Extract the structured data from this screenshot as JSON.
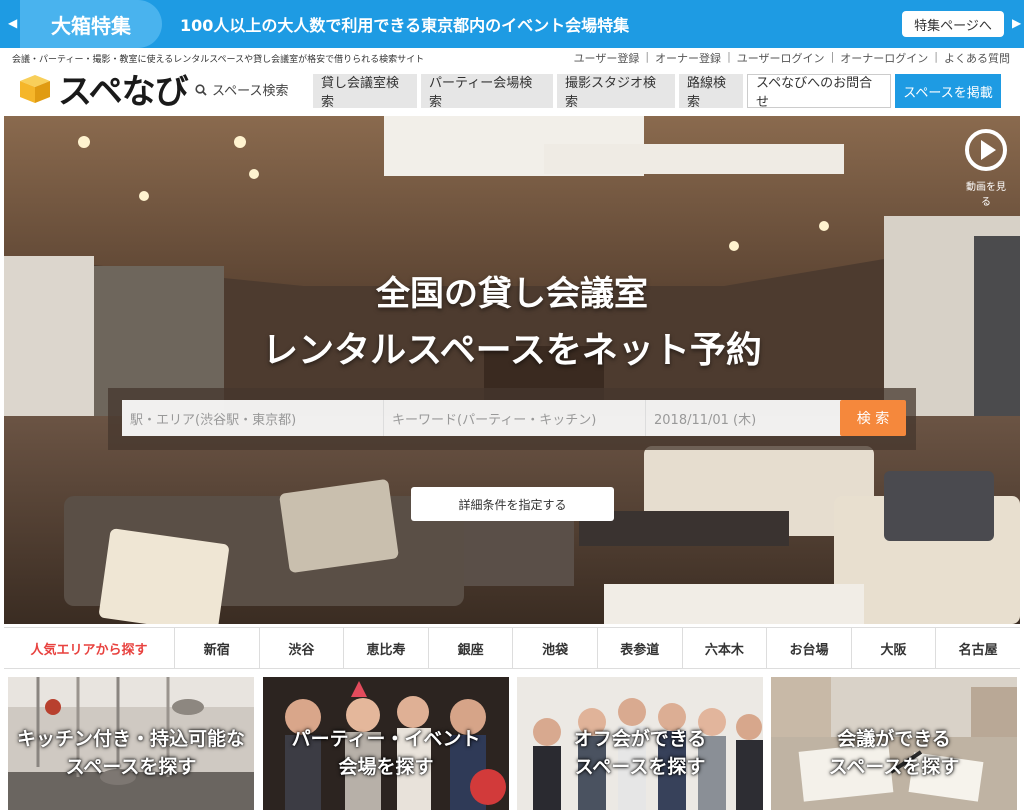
{
  "promo": {
    "badge": "大箱特集",
    "text": "100人以上の大人数で利用できる東京都内のイベント会場特集",
    "button": "特集ページへ"
  },
  "header": {
    "tagline": "会議・パーティー・撮影・教室に使えるレンタルスペースや貸し会議室が格安で借りられる検索サイト",
    "links": [
      "ユーザー登録",
      "オーナー登録",
      "ユーザーログイン",
      "オーナーログイン",
      "よくある質問"
    ],
    "logo": "スペなび",
    "space_search": "スペース検索",
    "nav": [
      "貸し会議室検索",
      "パーティー会場検索",
      "撮影スタジオ検索",
      "路線検索"
    ],
    "contact": "スペなびへのお問合せ",
    "post": "スペースを掲載"
  },
  "hero": {
    "play_label": "動画を見る",
    "headline1": "全国の貸し会議室",
    "headline2": "レンタルスペースをネット予約",
    "search": {
      "area_placeholder": "駅・エリア(渋谷駅・東京都)",
      "keyword_placeholder": "キーワード(パーティー・キッチン)",
      "date_value": "2018/11/01 (木)",
      "button": "検 索"
    },
    "detail_button": "詳細条件を指定する"
  },
  "areas": {
    "title": "人気エリアから探す",
    "items": [
      "新宿",
      "渋谷",
      "恵比寿",
      "銀座",
      "池袋",
      "表参道",
      "六本木",
      "お台場",
      "大阪",
      "名古屋"
    ]
  },
  "cards": [
    {
      "line1": "キッチン付き・持込可能な",
      "line2": "スペースを探す"
    },
    {
      "line1": "パーティー・イベント",
      "line2": "会場を探す"
    },
    {
      "line1": "オフ会ができる",
      "line2": "スペースを探す"
    },
    {
      "line1": "会議ができる",
      "line2": "スペースを探す"
    }
  ],
  "colors": {
    "brand_blue": "#1e9be3",
    "accent_orange": "#f5883c",
    "area_red": "#e8423f",
    "logo_yellow": "#f5b62a"
  }
}
